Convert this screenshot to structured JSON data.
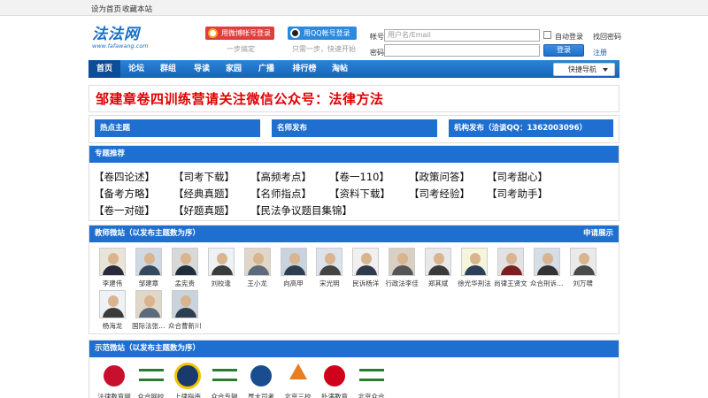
{
  "topbar": {
    "set_home": "设为首页",
    "bookmark": "收藏本站"
  },
  "logo": {
    "text": "法法网",
    "url": "www.fafawang.com"
  },
  "social": {
    "weibo_label": "用微博帐号登录",
    "weibo_sub": "一步搞定",
    "qq_label": "用QQ帐号登录",
    "qq_sub": "只需一步，快速开始"
  },
  "login": {
    "account_label": "帐号",
    "account_placeholder": "用户名/Email",
    "password_label": "密码",
    "auto_login": "自动登录",
    "find_password": "找回密码",
    "login_button": "登录",
    "register": "注册"
  },
  "nav": {
    "items": [
      "首页",
      "论坛",
      "群组",
      "导读",
      "家园",
      "广播",
      "排行榜",
      "淘帖"
    ],
    "quick_nav": "快捷导航"
  },
  "banner": {
    "text": "邹建章卷四训练营请关注微信公众号：法律方法"
  },
  "columns": {
    "hot": "热点主题",
    "teacher_publish": "名师发布",
    "org_publish": "机构发布（洽谈QQ：1362003096）"
  },
  "topics": {
    "title": "专题推荐",
    "row1": [
      "【卷四论述】",
      "【司考下载】",
      "【高频考点】",
      "【卷一110】",
      "【政策问答】",
      "【司考甜心】"
    ],
    "row2": [
      "【备考方略】",
      "【经典真题】",
      "【名师指点】",
      "【资料下载】",
      "【司考经验】",
      "【司考助手】"
    ],
    "row3": [
      "【卷一对碰】",
      "【好题真题】",
      "【民法争议题目集锦】"
    ]
  },
  "teachers": {
    "title": "教师微站（以发布主题数为序）",
    "apply": "申请展示",
    "row1": [
      "李建伟",
      "邹建章",
      "孟宪贵",
      "刘校逢",
      "王小龙",
      "向高甲",
      "宋光明",
      "民诉杨洋",
      "行政法李佳",
      "郑其斌",
      "徐光华刑法",
      "尚律王贤文",
      "众合刑诉…",
      "刘万啸"
    ],
    "row2": [
      "杨海龙",
      "国际法张…",
      "众合曹新川"
    ]
  },
  "sites": {
    "title": "示范微站（以发布主题数为序）",
    "items": [
      "法律教育网",
      "众合网校",
      "上律指南",
      "众合专辑",
      "厚大司考",
      "北京三校",
      "扑满教育",
      "北京众合"
    ]
  },
  "colors": {
    "brand_blue": "#1f6fd0",
    "banner_red": "#e00000",
    "weibo_red": "#e23d3d",
    "qq_blue": "#2b8ae0"
  }
}
